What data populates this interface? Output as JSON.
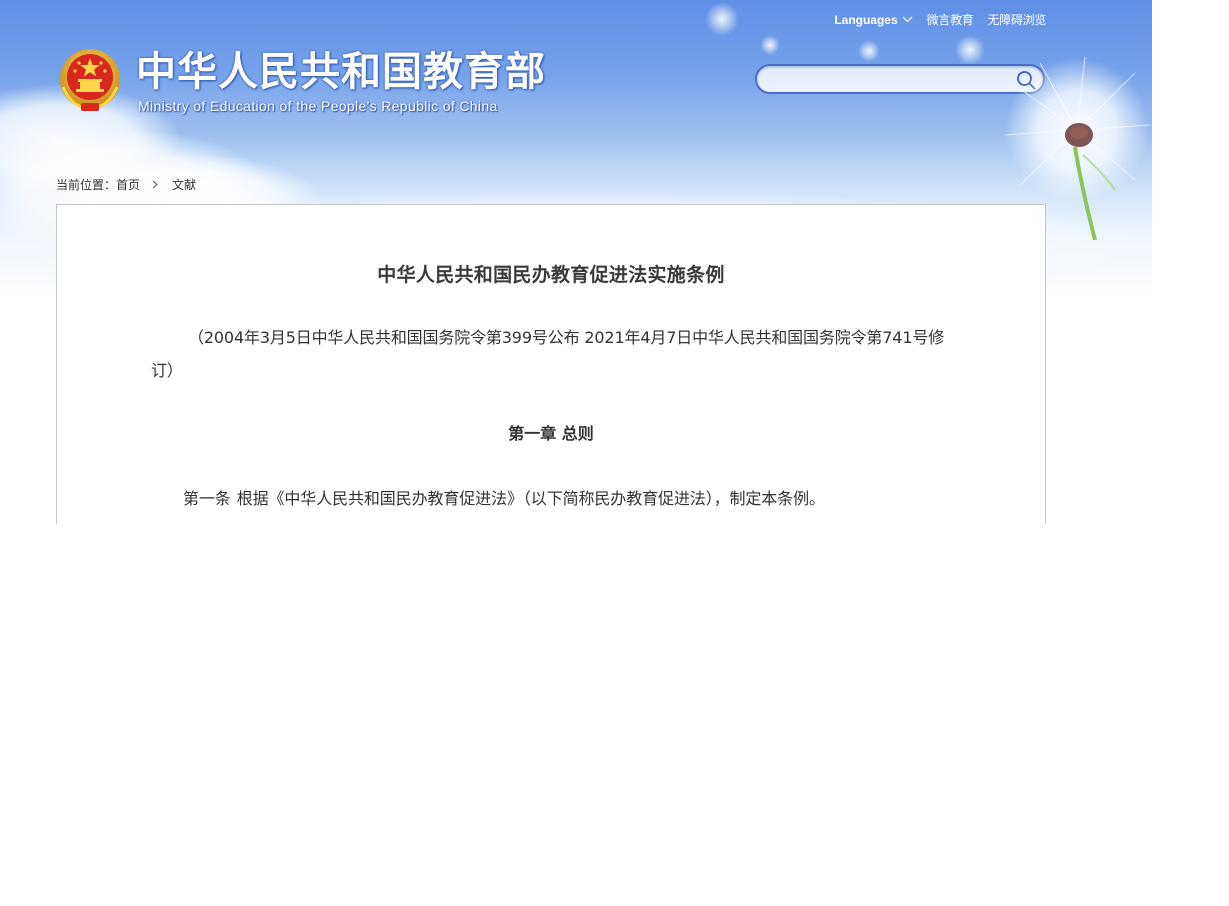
{
  "header": {
    "languages_label": "Languages",
    "links": [
      "微言教育",
      "无障碍浏览"
    ],
    "site_title": "中华人民共和国教育部",
    "site_subtitle": "Ministry of Education of the People's Republic of China",
    "search_placeholder": ""
  },
  "breadcrumb": {
    "prefix": "当前位置：",
    "items": [
      "首页",
      "文献"
    ]
  },
  "document": {
    "title": "中华人民共和国民办教育促进法实施条例",
    "note": "（2004年3月5日中华人民共和国国务院令第399号公布 2021年4月7日中华人民共和国国务院令第741号修订）",
    "chapter_1_title": "第一章 总则",
    "article_1_number": "第一条",
    "article_1_text": "根据《中华人民共和国民办教育促进法》（以下简称民办教育促进法），制定本条例。"
  },
  "colors": {
    "sky_top": "#5f90e6",
    "search_border": "#4b6fc6",
    "text": "#333333",
    "border": "#c6c6c6"
  },
  "icons": [
    "national-emblem-icon",
    "chevron-down-icon",
    "search-icon",
    "chevron-right-icon",
    "dandelion-decoration"
  ]
}
